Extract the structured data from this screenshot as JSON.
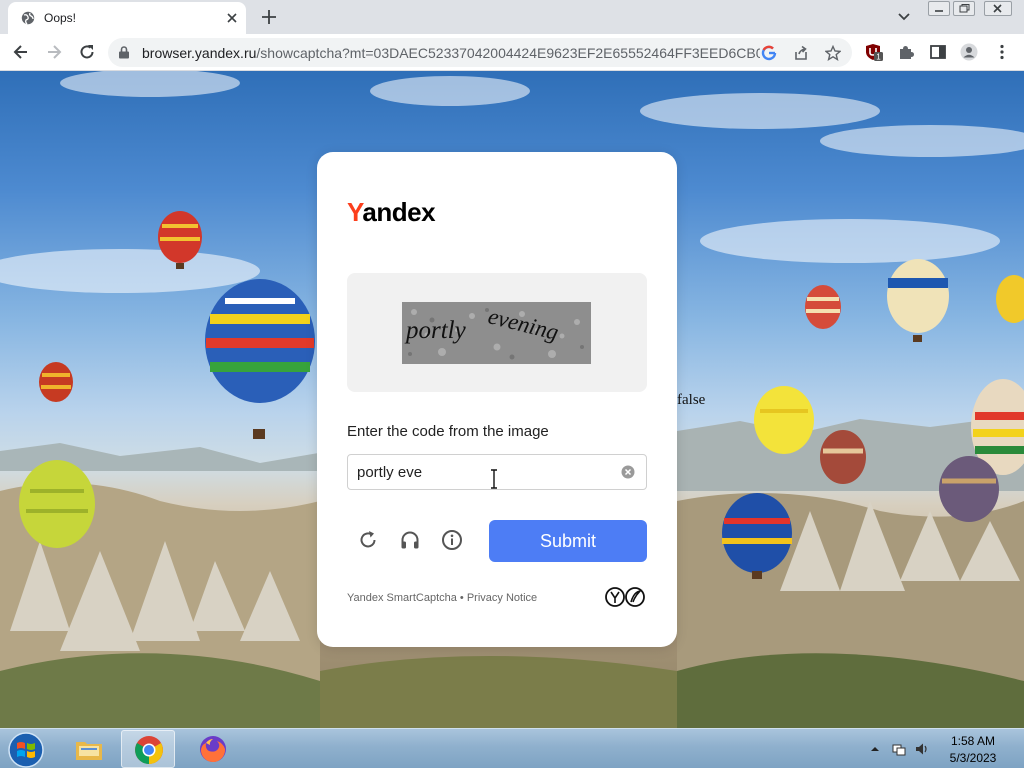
{
  "browser": {
    "tab_title": "Oops!",
    "url_host": "browser.yandex.ru",
    "url_path": "/showcaptcha?mt=03DAEC52337042004424E9623EF2E65552464FF3EED6CB03...",
    "extension_badge": "1"
  },
  "page": {
    "stray_text": "false"
  },
  "captcha_card": {
    "logo_first": "Y",
    "logo_rest": "andex",
    "captcha_text_1": "portly",
    "captcha_text_2": "evening",
    "prompt": "Enter the code from the image",
    "input_value": "portly eve",
    "submit_label": "Submit",
    "footer_brand": "Yandex SmartCaptcha",
    "footer_separator": " • ",
    "footer_privacy": "Privacy Notice",
    "colors": {
      "submit": "#4d7df5",
      "logo_accent": "#fc3f1d"
    }
  },
  "taskbar": {
    "time": "1:58 AM",
    "date": "5/3/2023",
    "items": [
      "file-explorer-icon",
      "chrome-icon",
      "firefox-icon"
    ]
  }
}
